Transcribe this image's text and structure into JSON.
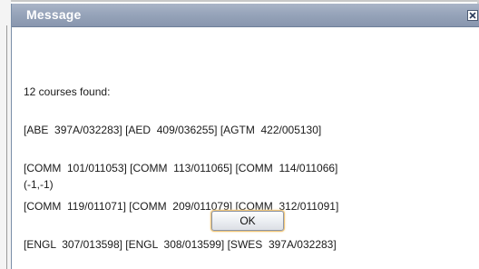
{
  "dialog": {
    "title": "Message",
    "close_icon": "close-icon"
  },
  "message": {
    "lines": [
      "12 courses found:",
      "[ABE  397A/032283] [AED  409/036255] [AGTM  422/005130]",
      "[COMM  101/011053] [COMM  113/011065] [COMM  114/011066]",
      "[COMM  119/011071] [COMM  209/011079] [COMM  312/011091]",
      "[ENGL  307/013598] [ENGL  308/013599] [SWES  397A/032283]"
    ],
    "code": "(-1,-1)"
  },
  "buttons": {
    "ok_label": "OK"
  }
}
